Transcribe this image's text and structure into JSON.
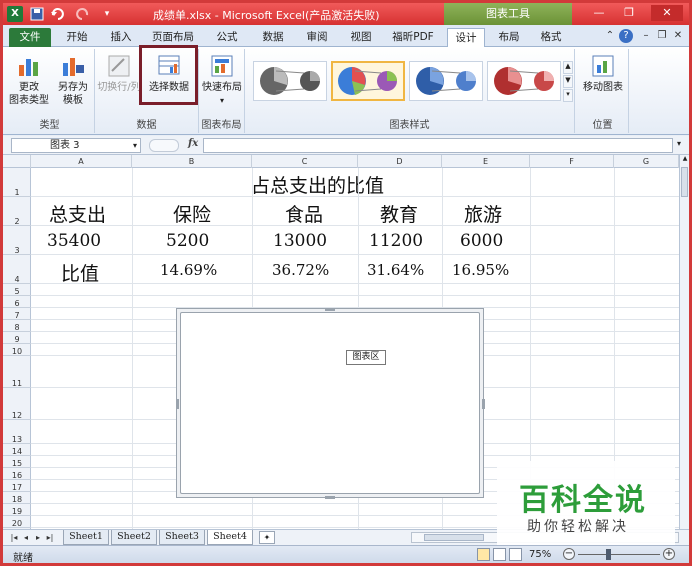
{
  "titlebar": {
    "title": "成绩单.xlsx - Microsoft Excel(产品激活失败)",
    "context_tab": "图表工具",
    "brand_color": "#d63131",
    "context_color": "#6b9236"
  },
  "tabs": [
    {
      "label": "文件"
    },
    {
      "label": "开始"
    },
    {
      "label": "插入"
    },
    {
      "label": "页面布局"
    },
    {
      "label": "公式"
    },
    {
      "label": "数据"
    },
    {
      "label": "审阅"
    },
    {
      "label": "视图"
    },
    {
      "label": "福昕PDF"
    },
    {
      "label": "设计"
    },
    {
      "label": "布局"
    },
    {
      "label": "格式"
    }
  ],
  "active_tab": "设计",
  "ribbon": {
    "type_group": {
      "label": "类型",
      "change_type": "更改\n图表类型",
      "save_template": "另存为\n模板"
    },
    "data_group": {
      "label": "数据",
      "switch_row_col": "切换行/列",
      "select_data": "选择数据"
    },
    "layout_group": {
      "label": "图表布局",
      "quick_layout": "快速布局"
    },
    "styles_group": {
      "label": "图表样式",
      "selected_index": 2
    },
    "location_group": {
      "label": "位置",
      "move_chart": "移动图表"
    }
  },
  "formula_bar": {
    "name_box": "图表 3",
    "fx": "fx",
    "formula": ""
  },
  "columns": [
    "A",
    "B",
    "C",
    "D",
    "E",
    "F",
    "G"
  ],
  "rows": [
    "1",
    "2",
    "3",
    "4",
    "5",
    "6",
    "7",
    "8",
    "9",
    "10",
    "11",
    "12",
    "13",
    "14",
    "15",
    "16",
    "17",
    "18",
    "19",
    "20",
    "21"
  ],
  "sheet": {
    "title": "占总支出的比值",
    "headers": [
      "总支出",
      "保险",
      "食品",
      "教育",
      "旅游"
    ],
    "amounts": [
      "35400",
      "5200",
      "13000",
      "11200",
      "6000"
    ],
    "ratio_label": "比值",
    "ratios": [
      "14.69%",
      "36.72%",
      "31.64%",
      "16.95%"
    ]
  },
  "chart": {
    "tooltip": "图表区"
  },
  "sheet_tabs": [
    "Sheet1",
    "Sheet2",
    "Sheet3",
    "Sheet4"
  ],
  "active_sheet": "Sheet4",
  "status": {
    "ready": "就绪",
    "zoom": "75%"
  },
  "watermark": {
    "title": "百科全说",
    "subtitle": "助你轻松解决",
    "color": "#2d9d3a"
  }
}
